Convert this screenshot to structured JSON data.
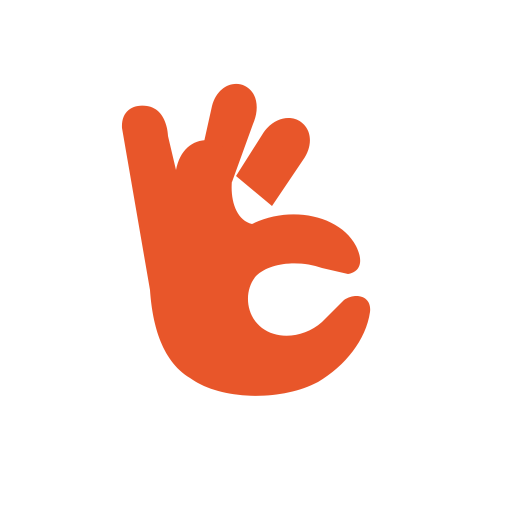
{
  "icon": {
    "name": "ok-hand-icon",
    "color": "#E8562A",
    "background": "#FFFFFF"
  }
}
